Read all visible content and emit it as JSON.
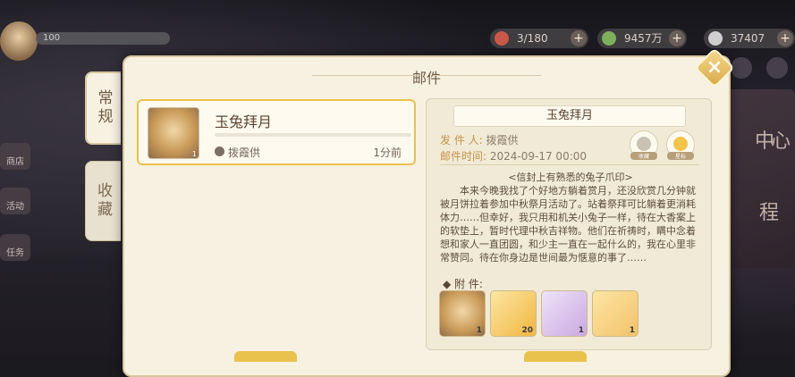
{
  "hud": {
    "level_text": "100",
    "resources": [
      {
        "icon": "stamina-icon",
        "value": "3/180",
        "color": "#c9584a"
      },
      {
        "icon": "leaf-coin-icon",
        "value": "9457万",
        "color": "#7db05a"
      },
      {
        "icon": "gem-icon",
        "value": "37407",
        "color": "#cfcfcf"
      }
    ],
    "left_nav": [
      "商店",
      "活动",
      "任务"
    ],
    "right_deco": [
      "中",
      "心",
      "程"
    ]
  },
  "panel": {
    "title": "邮件",
    "close_label": "×"
  },
  "tabs": [
    {
      "label": "常规",
      "active": true
    },
    {
      "label": "收藏",
      "active": false
    }
  ],
  "mail_list": [
    {
      "subject": "玉兔拜月",
      "sender": "拨霞供",
      "time": "1分前",
      "thumb_count": "1"
    }
  ],
  "detail": {
    "title": "玉兔拜月",
    "sender_label": "发 件 人:",
    "sender": "拨霞供",
    "time_label": "邮件时间:",
    "time": "2024-09-17  00:00",
    "btn_collect": "收藏",
    "btn_star": "星标",
    "body": [
      "<信封上有熟悉的兔子爪印>",
      "本来今晚我找了个好地方躺着赏月，还没欣赏几分钟就被月饼拉着参加中秋祭月活动了。站着祭拜可比躺着更消耗体力……但幸好，我只用和机关小兔子一样，待在大香案上的软垫上，暂时代理中秋吉祥物。他们在祈祷时，瞒中念着想和家人一直团圆，和少主一直在一起什么的，我在心里非常赞同。待在你身边是世间最为惬意的事了……"
    ],
    "attach_label": "附      件:",
    "attachments": [
      {
        "name": "avatar-frame-item",
        "count": "1",
        "color": "#e8d9b7"
      },
      {
        "name": "mooncake-crystal-item",
        "count": "20",
        "color": "#f0b640"
      },
      {
        "name": "rabbit-cake-item",
        "count": "1",
        "color": "#d6bfe6"
      },
      {
        "name": "rabbit-table-item",
        "count": "1",
        "color": "#f2c26a"
      }
    ]
  }
}
